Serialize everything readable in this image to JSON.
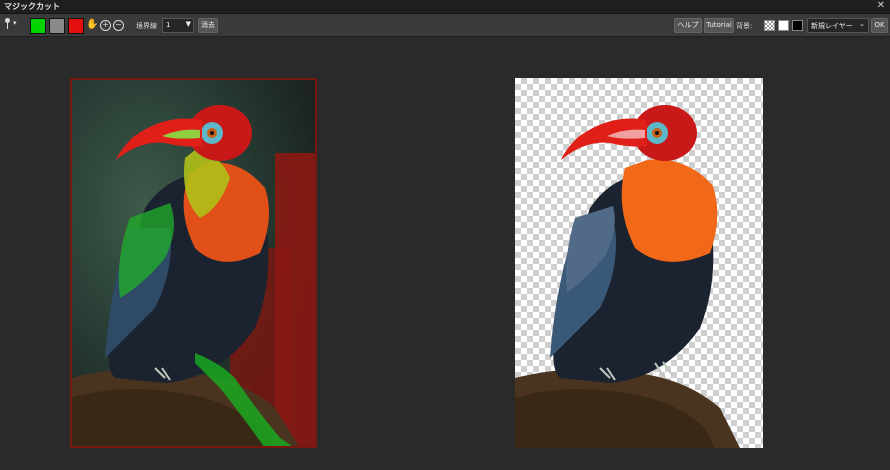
{
  "window": {
    "title": "マジックカット",
    "close_glyph": "✕"
  },
  "toolbar": {
    "brush_caret": "▾",
    "brush_width_label": "境界線",
    "brush_width_value": "1",
    "dropdown_arrow": "▼",
    "clear_label": "消去",
    "help_label": "ヘルプ",
    "tutorial_label": "Tutorial",
    "background_label": "背景:",
    "layer_select_value": "新規レイヤー",
    "layer_select_arrow": "⌄",
    "ok_label": "OK",
    "icons": {
      "hand": "✋",
      "zoom_in": "+",
      "zoom_out": "−"
    },
    "colors": {
      "keep": "#00d400",
      "neutral": "#8a8a8a",
      "remove": "#e41010"
    }
  },
  "canvases": {
    "left": {
      "description_icon": "toucan-source-image"
    },
    "right": {
      "description_icon": "toucan-cutout-preview"
    }
  }
}
